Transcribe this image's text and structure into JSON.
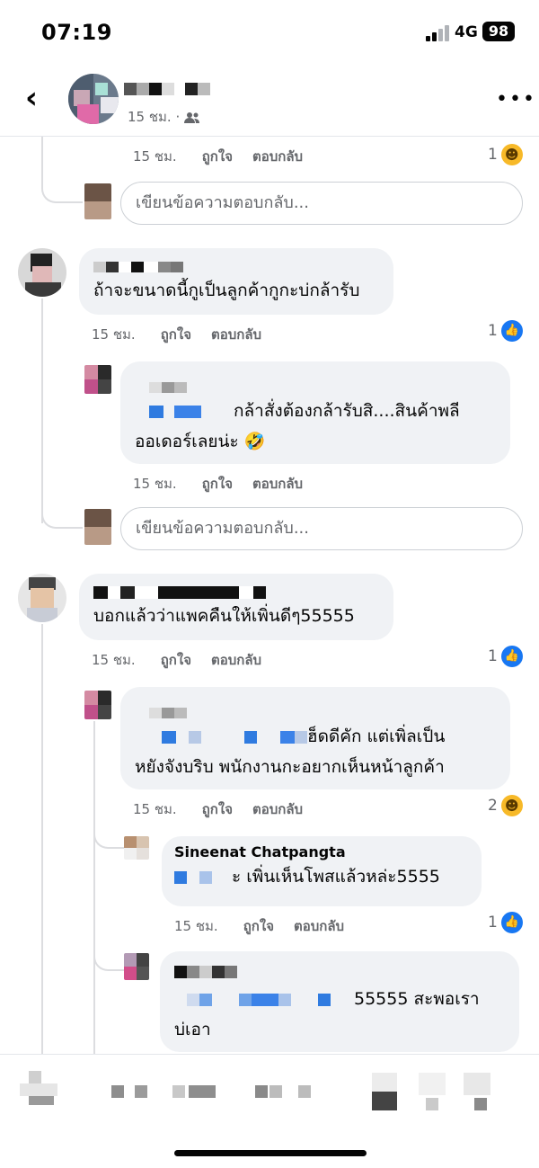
{
  "status_bar": {
    "time": "07:19",
    "network": "4G",
    "battery": "98"
  },
  "header": {
    "back_icon": "chevron-left-icon",
    "post_time": "15 ชม. ·",
    "audience_icon": "friends-icon",
    "more_icon": "ellipsis-icon"
  },
  "labels": {
    "time": "15 ชม.",
    "like": "ถูกใจ",
    "reply": "ตอบกลับ",
    "reply_placeholder": "เขียนข้อความตอบกลับ..."
  },
  "comments": {
    "c0": {
      "reaction_count": "1",
      "reaction": "haha"
    },
    "c1": {
      "text": "ถ้าจะขนาดนี้กูเป็นลูกค้ากูกะบ่กล้ารับ",
      "reaction_count": "1",
      "reaction": "like",
      "reply": {
        "text_1": "กล้าสั่งต้องกล้ารับสิ....สินค้าพลี",
        "text_2": "ออเดอร์เลยน่ะ 🤣"
      }
    },
    "c2": {
      "text": "บอกแล้วว่าแพคคืนให้เพิ่นดีๆ55555",
      "reaction_count": "1",
      "reaction": "like",
      "reply1": {
        "text_1": "ฮ็ดดีคัก แต่เพิ่ลเป็น",
        "text_2": "หยังจังบริบ พนักงานกะอยากเห็นหน้าลูกค้า",
        "reaction_count": "2",
        "reaction": "haha"
      },
      "reply2": {
        "name": "Sineenat Chatpangta",
        "text": "ะ เพิ่นเห็นโพสแล้วหล่ะ5555",
        "reaction_count": "1",
        "reaction": "like"
      },
      "reply3": {
        "text_1": "55555 สะพอเรา",
        "text_2": "บ่เอา"
      }
    }
  }
}
